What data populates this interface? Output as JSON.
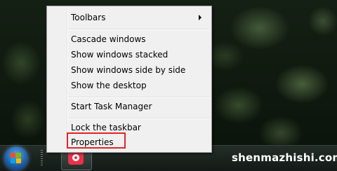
{
  "context_menu": {
    "items": [
      {
        "label": "Toolbars",
        "has_submenu": true
      },
      {
        "label": "Cascade windows"
      },
      {
        "label": "Show windows stacked"
      },
      {
        "label": "Show windows side by side"
      },
      {
        "label": "Show the desktop"
      },
      {
        "label": "Start Task Manager"
      },
      {
        "label": "Lock the taskbar"
      },
      {
        "label": "Properties",
        "highlighted": true
      }
    ]
  },
  "watermark": {
    "text": "shenmazhishi.com"
  },
  "colors": {
    "highlight_border": "#e0262a",
    "menu_background": "#f0f0f0",
    "start_orb": "#1f5fa8",
    "app_icon": "#e8324a"
  },
  "icons": {
    "start": "windows-flag-icon",
    "taskbar_app": "camera-app-icon",
    "submenu": "chevron-right-icon"
  }
}
